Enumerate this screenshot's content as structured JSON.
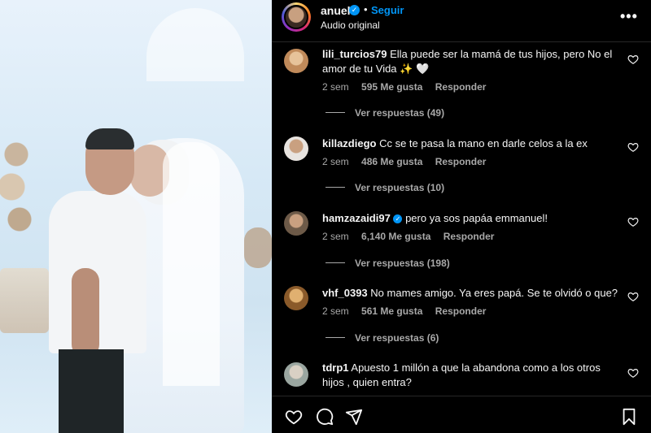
{
  "post": {
    "username": "anuel",
    "verified_glyph": "✓",
    "separator": "•",
    "follow_label": "Seguir",
    "audio_label": "Audio original",
    "more_label": "•••"
  },
  "comments": [
    {
      "username": "lili_turcios79",
      "verified": false,
      "text": "Ella puede ser la mamá de tus hijos, pero No el amor de tu Vida ✨ 🤍",
      "time": "2 sem",
      "likes": "595 Me gusta",
      "reply_label": "Responder",
      "replies_label": "Ver respuestas (49)",
      "avatar_color": "#c08a5a"
    },
    {
      "username": "killazdiego",
      "verified": false,
      "text": "Cc se te pasa la mano en darle celos a la ex",
      "time": "2 sem",
      "likes": "486 Me gusta",
      "reply_label": "Responder",
      "replies_label": "Ver respuestas (10)",
      "avatar_color": "#d9d2cc"
    },
    {
      "username": "hamzazaidi97",
      "verified": true,
      "text": "pero ya sos papáa emmanuel!",
      "time": "2 sem",
      "likes": "6,140 Me gusta",
      "reply_label": "Responder",
      "replies_label": "Ver respuestas (198)",
      "avatar_color": "#6d5a48"
    },
    {
      "username": "vhf_0393",
      "verified": false,
      "text": "No mames amigo. Ya eres papá. Se te olvidó o que?",
      "time": "2 sem",
      "likes": "561 Me gusta",
      "reply_label": "Responder",
      "replies_label": "Ver respuestas (6)",
      "avatar_color": "#8a5a2a"
    },
    {
      "username": "tdrp1",
      "verified": false,
      "text": "Apuesto 1 millón a que la abandona como a los otros hijos , quien entra?",
      "avatar_color": "#9aa6a0"
    }
  ],
  "footer": {
    "icons": [
      "heart-icon",
      "comment-icon",
      "share-icon",
      "bookmark-icon"
    ]
  },
  "colors": {
    "accent": "#0095f6",
    "muted": "#a8a8a8",
    "background": "#000000"
  }
}
